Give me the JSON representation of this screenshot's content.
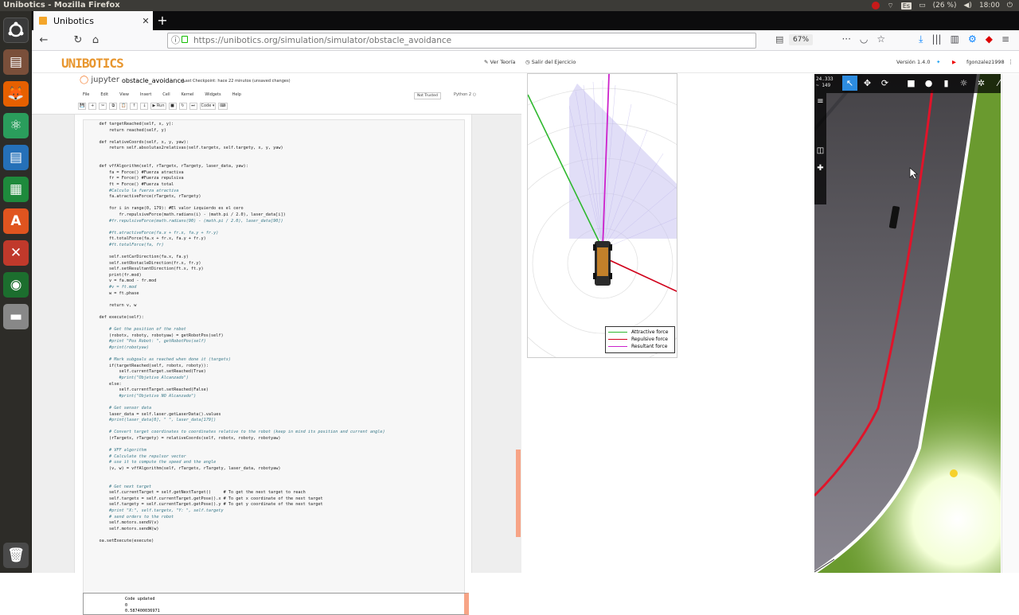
{
  "window": {
    "title": "Unibotics - Mozilla Firefox"
  },
  "tray": {
    "lang": "Es",
    "battery": "(26 %)",
    "time": "18:00"
  },
  "browser": {
    "tab_title": "Unibotics",
    "url": "https://unibotics.org/simulation/simulator/obstacle_avoidance",
    "zoom": "67%",
    "dots": "···"
  },
  "site": {
    "logo": "UNIBOTICS",
    "theory": "Ver Teoría",
    "exit": "Salir del Ejercicio",
    "version": "Versión 1.4.0",
    "user": "fgonzalez1998"
  },
  "jupyter": {
    "brand": "jupyter",
    "notebook_name": "obstacle_avoidance",
    "checkpoint": "Last Checkpoint: hace 22 minutos  (unsaved changes)",
    "menu": [
      "File",
      "Edit",
      "View",
      "Insert",
      "Cell",
      "Kernel",
      "Widgets",
      "Help"
    ],
    "trusted": "Not Trusted",
    "kernel": "Python 2",
    "toolbar": [
      "💾",
      "+",
      "✂",
      "⧉",
      "📋",
      "↑",
      "↓",
      "▶ Run",
      "■",
      "↻",
      "⏭",
      "Code ▾",
      "⌨"
    ],
    "code_lines": [
      "    def targetReached(self, x, y):",
      "        return reached(self, y)",
      "",
      "    def relativeCoords(self, x, y, yaw):",
      "        return self.absolutas2relativas(self.targetx, self.targety, x, y, yaw)",
      "",
      "",
      "    def vffAlgorithm(self, rTargetx, rTargety, laser_data, yaw):",
      "        fa = Force() #Fuerza atractiva",
      "        fr = Force() #Fuerza repulsiva",
      "        ft = Force() #Fuerza total",
      "        #Calculo la fuerza atractiva",
      "        fa.atractiveForce(rTargetx, rTargety)",
      "",
      "        for i in range(0, 179): #El valor izquierdo es el cero",
      "            fr.repulsiveForce(math.radians(i) - (math.pi / 2.0), laser_data[i])",
      "        #fr.repulsiveForce(math.radians(90) - (math.pi / 2.0), laser_data[90])",
      "",
      "        #ft.atractiveForce(fa.x + fr.x, fa.y + fr.y)",
      "        ft.totalForce(fa.x + fr.x, fa.y + fr.y)",
      "        #ft.totalForce(fa, fr)",
      "",
      "        self.setCarDirection(fa.x, fa.y)",
      "        self.setObstacleDirection(fr.x, fr.y)",
      "        self.setResultantDirection(ft.x, ft.y)",
      "        print(fr.mod)",
      "        v = fa.mod - fr.mod",
      "        #v = ft.mod",
      "        w = ft.phase",
      "",
      "        return v, w",
      "",
      "    def execute(self):",
      "",
      "        # Get the position of the robot",
      "        (robotx, roboty, robotyaw) = getRobotPos(self)",
      "        #print \"Pos Robot: \", getRobotPos(self)",
      "        #print(robotyaw)",
      "",
      "        # Mark subgoals as reached when done it (targets)",
      "        if(targetReached(self, robotx, roboty)):",
      "            self.currentTarget.setReached(True)",
      "            #print(\"Objetivo Alcanzado\")",
      "        else:",
      "            self.currentTarget.setReached(False)",
      "            #print(\"Objetivo NO Alcanzado\")",
      "",
      "        # Get sensor data",
      "        laser_data = self.laser.getLaserData().values",
      "        #print(laser_data[0], \" \", laser_data[179])",
      "",
      "        # Convert target coordinates to coordinates relative to the robot (keep in mind its position and current angle)",
      "        (rTargetx, rTargety) = relativeCoords(self, robotx, roboty, robotyaw)",
      "",
      "        # VFF algorithm",
      "        # Calculate the repulsor vector",
      "        # use it to compute the speed and the angle",
      "        (v, w) = vffAlgorithm(self, rTargetx, rTargety, laser_data, robotyaw)",
      "",
      "",
      "        # Get next target",
      "        self.currentTarget = self.getNextTarget()     # To get the next target to reach",
      "        self.targetx = self.currentTarget.getPose().x # To get x coordinate of the next target",
      "        self.targety = self.currentTarget.getPose().y # To get y coordinate of the next target",
      "        #print \"X:\", self.targetx, \"Y: \", self.targety",
      "        # send orders to the robot",
      "        self.motors.sendV(v)",
      "        self.motors.sendW(w)",
      "",
      "    oa.setExecute(execute)"
    ],
    "output_lines": [
      "Code updated",
      "0",
      "0.587400036971"
    ]
  },
  "vff": {
    "legend": [
      {
        "label": "Attractive force",
        "color": "#2fb82f"
      },
      {
        "label": "Repulsive force",
        "color": "#d0021b"
      },
      {
        "label": "Resultant force",
        "color": "#cc22cc"
      }
    ]
  },
  "sim": {
    "stat_line1": "24.333",
    "stat_line2": "~ 149"
  }
}
